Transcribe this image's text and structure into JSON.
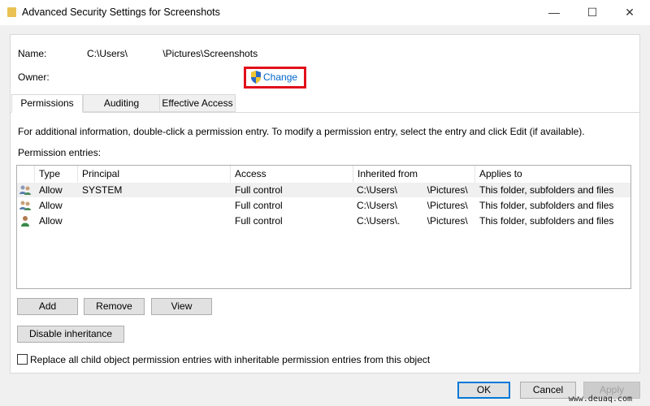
{
  "window": {
    "title": "Advanced Security Settings for Screenshots",
    "minimize": "—",
    "maximize": "☐",
    "close": "✕"
  },
  "name": {
    "label": "Name:",
    "value": "C:\\Users\\             \\Pictures\\Screenshots"
  },
  "owner": {
    "label": "Owner:",
    "value": "",
    "change_label": "Change"
  },
  "tabs": [
    {
      "label": "Permissions",
      "active": true
    },
    {
      "label": "Auditing"
    },
    {
      "label": "Effective Access"
    }
  ],
  "info_text": "For additional information, double-click a permission entry. To modify a permission entry, select the entry and click Edit (if available).",
  "entries_label": "Permission entries:",
  "columns": [
    "Type",
    "Principal",
    "Access",
    "Inherited from",
    "Applies to"
  ],
  "rows": [
    {
      "icon": "group-users-icon",
      "type": "Allow",
      "principal": "SYSTEM",
      "access": "Full control",
      "inherited": "C:\\Users\\           \\Pictures\\",
      "applies": "This folder, subfolders and files",
      "selected": true
    },
    {
      "icon": "group-users-icon",
      "type": "Allow",
      "principal": "",
      "access": "Full control",
      "inherited": "C:\\Users\\           \\Pictures\\",
      "applies": "This folder, subfolders and files"
    },
    {
      "icon": "user-icon",
      "type": "Allow",
      "principal": "",
      "access": "Full control",
      "inherited": "C:\\Users\\.          \\Pictures\\",
      "applies": "This folder, subfolders and files"
    }
  ],
  "buttons": {
    "add": "Add",
    "remove": "Remove",
    "view": "View",
    "disable_inheritance": "Disable inheritance",
    "ok": "OK",
    "cancel": "Cancel",
    "apply": "Apply"
  },
  "replace_checkbox": {
    "label": "Replace all child object permission entries with inheritable permission entries from this object",
    "checked": false
  },
  "watermark": "www.deuaq.com"
}
